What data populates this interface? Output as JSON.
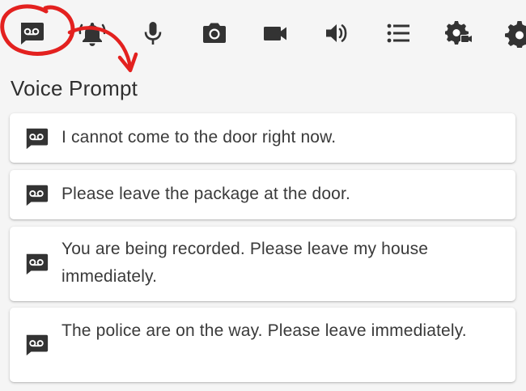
{
  "toolbar": {
    "items": [
      {
        "name": "voicemail",
        "icon": "voicemail-icon",
        "active": true
      },
      {
        "name": "notifications",
        "icon": "bell-icon"
      },
      {
        "name": "microphone",
        "icon": "microphone-icon"
      },
      {
        "name": "camera",
        "icon": "camera-icon"
      },
      {
        "name": "video",
        "icon": "video-camera-icon"
      },
      {
        "name": "volume",
        "icon": "volume-icon"
      },
      {
        "name": "list",
        "icon": "list-icon"
      },
      {
        "name": "video-settings",
        "icon": "gear-video-icon"
      },
      {
        "name": "settings",
        "icon": "gear-icon"
      }
    ]
  },
  "page": {
    "title": "Voice Prompt"
  },
  "prompts": [
    {
      "text": "I cannot come to the door right now.",
      "icon": "voicemail-icon"
    },
    {
      "text": "Please leave the package at the door.",
      "icon": "voicemail-icon"
    },
    {
      "text": "You are being recorded. Please leave my house immediately.",
      "icon": "voicemail-icon"
    },
    {
      "text": "The police are on the way. Please leave immediately.",
      "icon": "voicemail-icon"
    }
  ],
  "colors": {
    "icon": "#333333",
    "annotation": "#e3211f",
    "background": "#f5f5f5",
    "card": "#ffffff"
  }
}
